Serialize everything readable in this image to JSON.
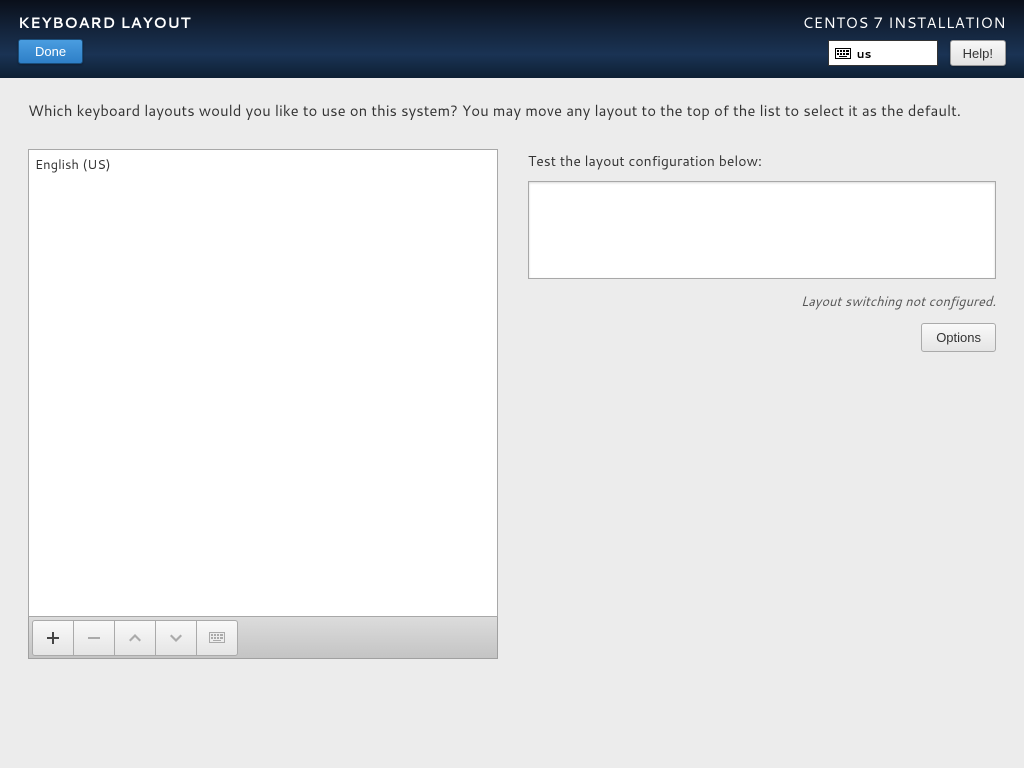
{
  "header": {
    "title": "KEYBOARD LAYOUT",
    "installer_title": "CENTOS 7 INSTALLATION",
    "done_label": "Done",
    "help_label": "Help!",
    "lang_code": "us"
  },
  "main": {
    "instruction": "Which keyboard layouts would you like to use on this system?  You may move any layout to the top of the list to select it as the default.",
    "layouts": [
      "English (US)"
    ],
    "test_label": "Test the layout configuration below:",
    "test_value": "",
    "switch_note": "Layout switching not configured.",
    "options_label": "Options"
  }
}
